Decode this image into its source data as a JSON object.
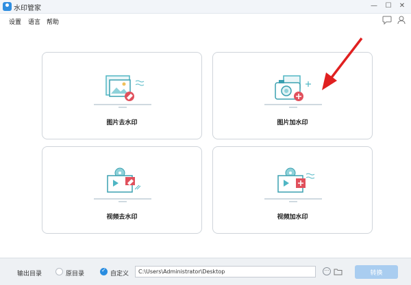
{
  "window": {
    "title": "水印管家",
    "controls": [
      "minimize",
      "maximize",
      "close"
    ]
  },
  "menu": {
    "items": [
      "设置",
      "语言",
      "帮助"
    ],
    "right_icons": [
      "chat-icon",
      "user-icon"
    ]
  },
  "cards": [
    {
      "label": "图片去水印",
      "icon": "image-remove-watermark-icon"
    },
    {
      "label": "图片加水印",
      "icon": "image-add-watermark-icon"
    },
    {
      "label": "视频去水印",
      "icon": "video-remove-watermark-icon"
    },
    {
      "label": "视频加水印",
      "icon": "video-add-watermark-icon"
    }
  ],
  "footer": {
    "output_label": "输出目录",
    "option_original": "原目录",
    "option_custom": "自定义",
    "selected_option": "自定义",
    "path_value": "C:\\Users\\Administrator\\Desktop",
    "convert_label": "转换"
  },
  "colors": {
    "accent": "#2a8de0",
    "red_badge": "#e0505c",
    "teal": "#4fb6c4",
    "arrow": "#e02020",
    "convert_button": "#a9cdf0"
  }
}
